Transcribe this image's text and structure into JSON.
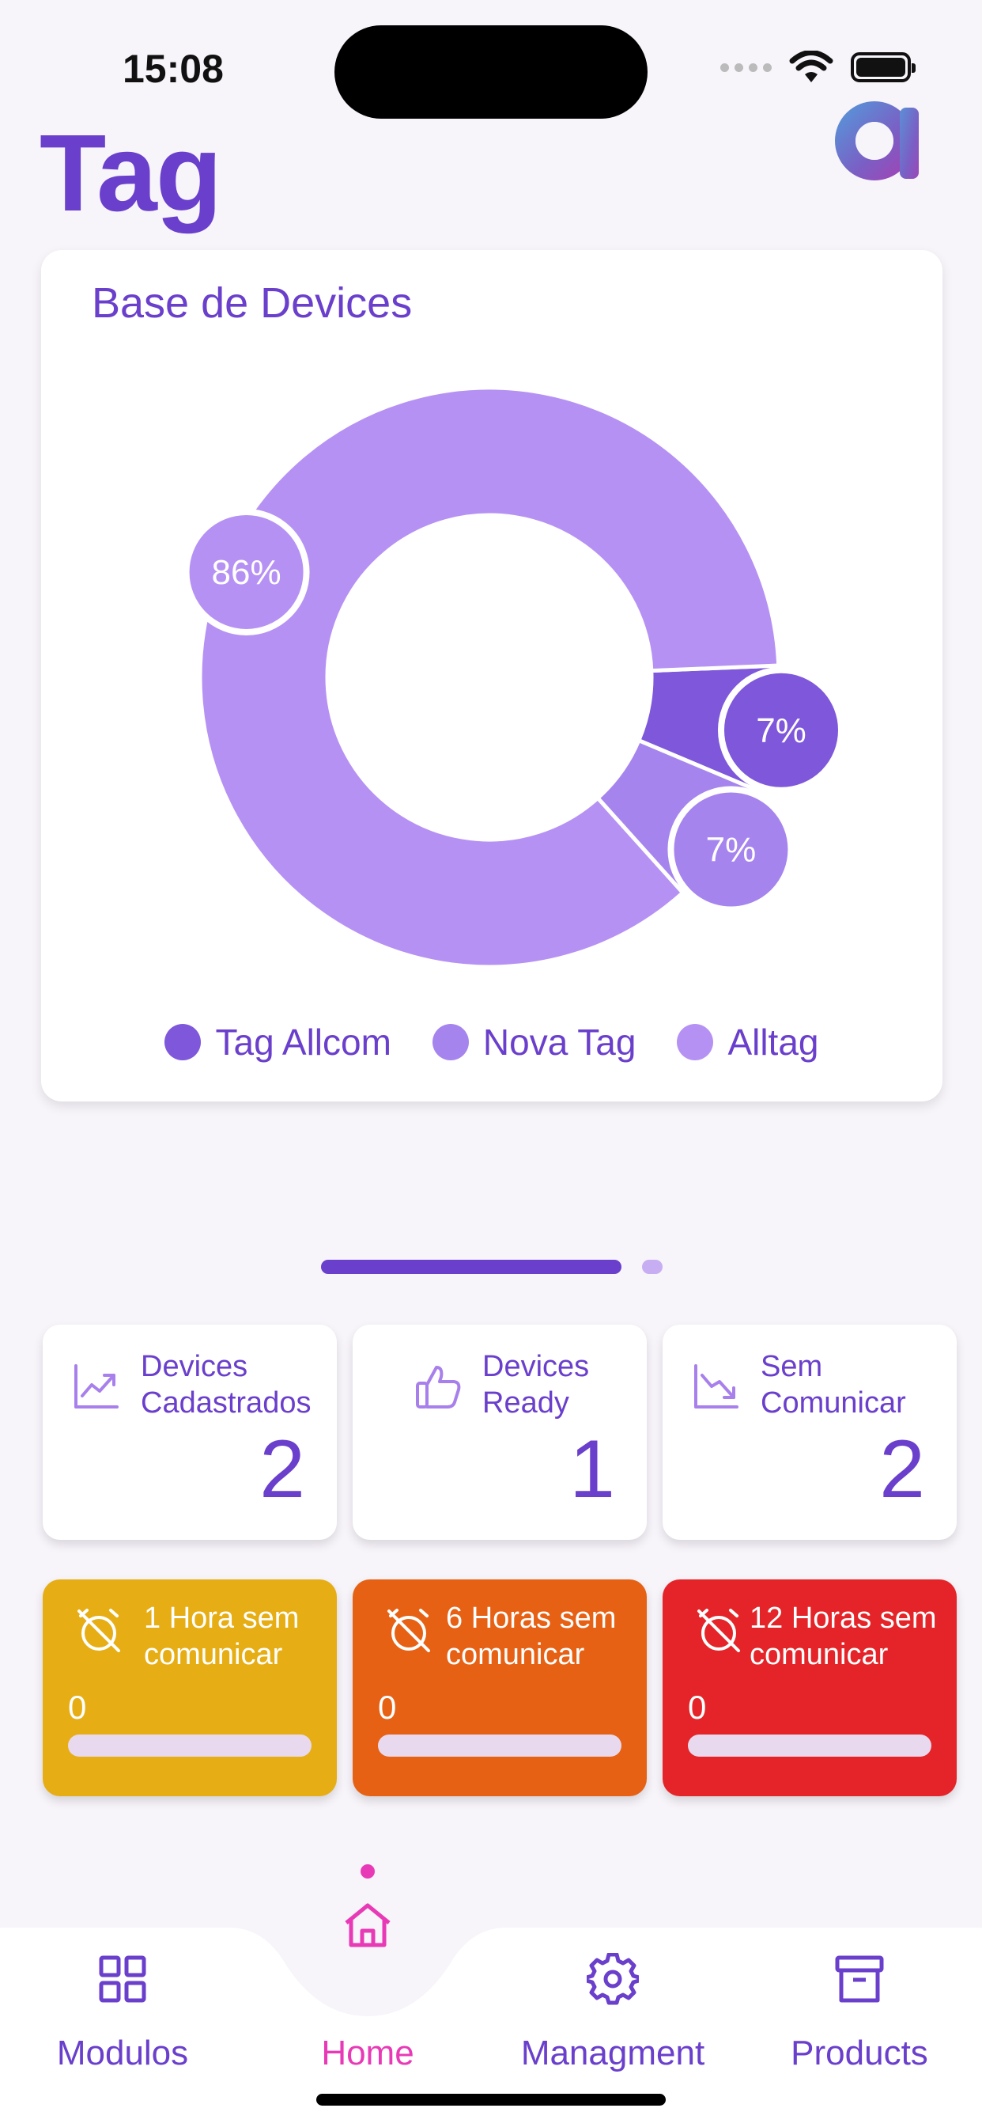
{
  "status_bar": {
    "time": "15:08"
  },
  "header": {
    "title": "Tag"
  },
  "chart_card": {
    "title": "Base de Devices"
  },
  "chart_data": {
    "type": "pie",
    "title": "Base de Devices",
    "slices": [
      {
        "name": "Tag Allcom",
        "value": 7,
        "label": "7%",
        "color": "#7E57DB"
      },
      {
        "name": "Nova Tag",
        "value": 7,
        "label": "7%",
        "color": "#A684EE"
      },
      {
        "name": "Alltag",
        "value": 86,
        "label": "86%",
        "color": "#B691F4"
      }
    ],
    "legend_position": "bottom"
  },
  "stats": [
    {
      "label_line1": "Devices",
      "label_line2": "Cadastrados",
      "value": "2",
      "icon": "trending-up-icon"
    },
    {
      "label_line1": "Devices",
      "label_line2": "Ready",
      "value": "1",
      "icon": "thumbs-up-icon"
    },
    {
      "label_line1": "Sem",
      "label_line2": "Comunicar",
      "value": "2",
      "icon": "trending-down-icon"
    }
  ],
  "alerts": [
    {
      "label_line1": "1 Hora sem",
      "label_line2": "comunicar",
      "value": "0",
      "color": "#E6AE14",
      "progress": 0
    },
    {
      "label_line1": "6 Horas sem",
      "label_line2": "comunicar",
      "value": "0",
      "color": "#E66114",
      "progress": 0
    },
    {
      "label_line1": "12 Horas sem",
      "label_line2": "comunicar",
      "value": "0",
      "color": "#E42428",
      "progress": 0
    }
  ],
  "nav": {
    "items": [
      {
        "label": "Modulos",
        "icon": "grid-icon"
      },
      {
        "label": "Home",
        "icon": "home-icon",
        "active": true
      },
      {
        "label": "Managment",
        "icon": "gear-icon"
      },
      {
        "label": "Products",
        "icon": "archive-icon"
      }
    ]
  },
  "colors": {
    "primary": "#6A3FCC",
    "active_nav": "#E83AB6",
    "background": "#F7F4FA"
  }
}
